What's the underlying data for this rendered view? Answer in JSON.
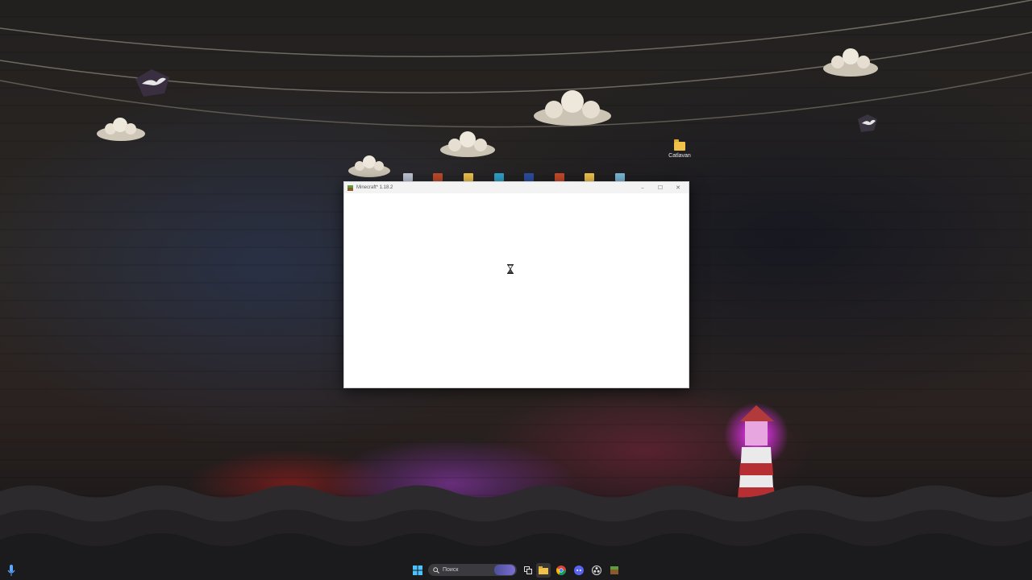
{
  "desktop": {
    "icons": [
      {
        "label": "Catlavan",
        "icon": "folder-icon"
      }
    ]
  },
  "window": {
    "title": "Minecraft* 1.18.2",
    "app_icon": "minecraft-icon",
    "controls": {
      "minimize": "–",
      "maximize": "☐",
      "close": "✕"
    },
    "status_icon": "hourglass-icon"
  },
  "taskbar": {
    "search_placeholder": "Поиск",
    "start_icon": "windows-start-icon",
    "pinned": [
      {
        "name": "task-view",
        "icon": "task-view-icon"
      },
      {
        "name": "file-explorer",
        "icon": "file-explorer-icon"
      },
      {
        "name": "chrome",
        "icon": "chrome-icon"
      },
      {
        "name": "discord",
        "icon": "discord-icon"
      },
      {
        "name": "obs",
        "icon": "obs-icon"
      },
      {
        "name": "minecraft-launcher",
        "icon": "minecraft-icon"
      }
    ],
    "tray_icon": "microphone-icon"
  },
  "colors": {
    "folder": "#f0c24a",
    "window_bg": "#ffffff",
    "titlebar_bg": "#f3f3f3",
    "start_blue": "#4cc2ff"
  }
}
